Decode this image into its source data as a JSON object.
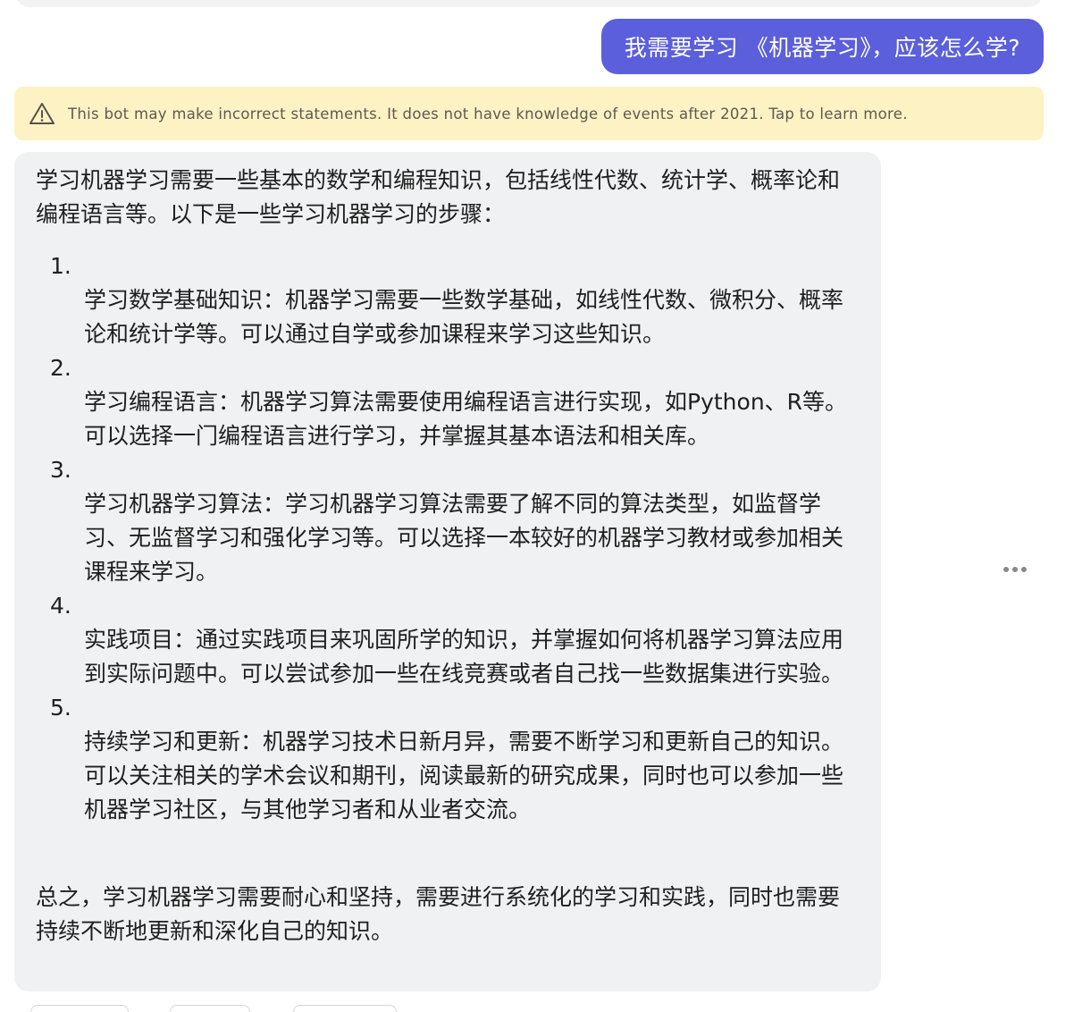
{
  "conversation": {
    "user_message": "我需要学习 《机器学习》，应该怎么学?",
    "warning": {
      "icon": "warning-triangle-icon",
      "text": "This bot may make incorrect statements. It does not have knowledge of events after 2021. Tap to learn more."
    },
    "bot_reply": {
      "intro": "学习机器学习需要一些基本的数学和编程知识，包括线性代数、统计学、概率论和编程语言等。以下是一些学习机器学习的步骤：",
      "steps": [
        {
          "number": "1.",
          "text": "学习数学基础知识：机器学习需要一些数学基础，如线性代数、微积分、概率论和统计学等。可以通过自学或参加课程来学习这些知识。"
        },
        {
          "number": "2.",
          "text": "学习编程语言：机器学习算法需要使用编程语言进行实现，如Python、R等。可以选择一门编程语言进行学习，并掌握其基本语法和相关库。"
        },
        {
          "number": "3.",
          "text": "学习机器学习算法：学习机器学习算法需要了解不同的算法类型，如监督学习、无监督学习和强化学习等。可以选择一本较好的机器学习教材或参加相关课程来学习。"
        },
        {
          "number": "4.",
          "text": "实践项目：通过实践项目来巩固所学的知识，并掌握如何将机器学习算法应用到实际问题中。可以尝试参加一些在线竞赛或者自己找一些数据集进行实验。"
        },
        {
          "number": "5.",
          "text": "持续学习和更新：机器学习技术日新月异，需要不断学习和更新自己的知识。可以关注相关的学术会议和期刊，阅读最新的研究成果，同时也可以参加一些机器学习社区，与其他学习者和从业者交流。"
        }
      ],
      "summary": "总之，学习机器学习需要耐心和坚持，需要进行系统化的学习和实践，同时也需要持续不断地更新和深化自己的知识。"
    },
    "more_options_icon": "more-horizontal-icon"
  },
  "colors": {
    "user_bubble": "#5b5fdc",
    "warning_bg": "#fdf2c4",
    "bot_bubble": "#f0f1f2"
  }
}
